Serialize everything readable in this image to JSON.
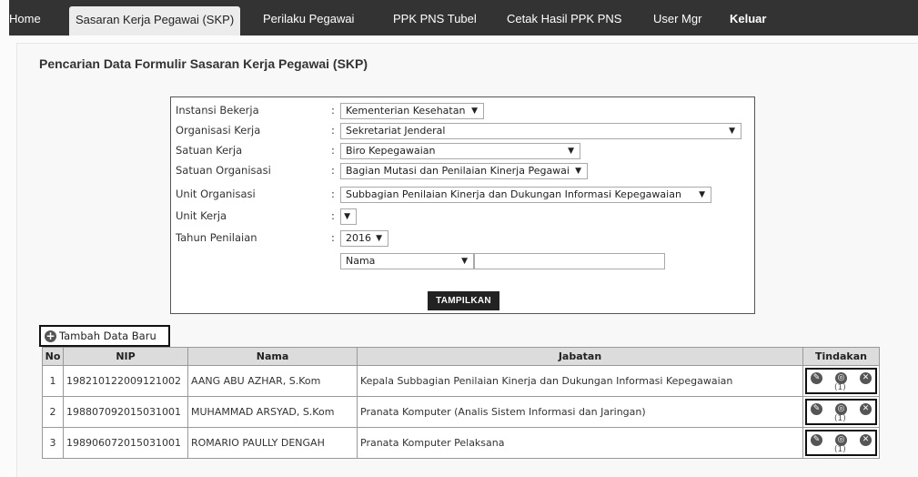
{
  "nav": {
    "items": [
      {
        "label": "Home"
      },
      {
        "label": "Sasaran Kerja Pegawai (SKP)"
      },
      {
        "label": "Perilaku Pegawai"
      },
      {
        "label": "PPK PNS Tubel"
      },
      {
        "label": "Cetak Hasil PPK PNS"
      },
      {
        "label": "User Mgr"
      },
      {
        "label": "Keluar"
      }
    ],
    "active": "Sasaran Kerja Pegawai (SKP)"
  },
  "page_title": "Pencarian Data Formulir Sasaran Kerja Pegawai (SKP)",
  "form": {
    "colon": ":",
    "rows": [
      {
        "label": "Instansi Bekerja",
        "value": "Kementerian Kesehatan"
      },
      {
        "label": "Organisasi Kerja",
        "value": "Sekretariat Jenderal"
      },
      {
        "label": "Satuan Kerja",
        "value": "Biro Kepegawaian"
      },
      {
        "label": "Satuan Organisasi",
        "value": "Bagian Mutasi dan Penilaian Kinerja Pegawai"
      },
      {
        "label": "Unit Organisasi",
        "value": "Subbagian Penilaian Kinerja dan Dukungan Informasi Kepegawaian"
      },
      {
        "label": "Unit Kerja",
        "value": ""
      },
      {
        "label": "Tahun Penilaian",
        "value": "2016"
      }
    ],
    "search_field": "Nama",
    "search_value": "",
    "submit_label": "TAMPILKAN",
    "arrow": "▼"
  },
  "add_button": {
    "icon": "plus-circle-icon",
    "label": "Tambah Data Baru"
  },
  "table": {
    "headers": [
      "No",
      "NIP",
      "Nama",
      "Jabatan",
      "Tindakan"
    ],
    "rows": [
      {
        "no": "1",
        "nip": "198210122009121002",
        "nama": "AANG ABU AZHAR, S.Kom",
        "jabatan": "Kepala Subbagian Penilaian Kinerja dan Dukungan Informasi Kepegawaian",
        "count": "(1)"
      },
      {
        "no": "2",
        "nip": "198807092015031001",
        "nama": "MUHAMMAD ARSYAD, S.Kom",
        "jabatan": "Pranata Komputer (Analis Sistem Informasi dan Jaringan)",
        "count": "(1)"
      },
      {
        "no": "3",
        "nip": "198906072015031001",
        "nama": "ROMARIO PAULLY DENGAH",
        "jabatan": "Pranata Komputer Pelaksana",
        "count": "(1)"
      }
    ],
    "action_icons": [
      "edit-icon",
      "view-icon",
      "delete-icon"
    ]
  },
  "colors": {
    "navbar": "#333333",
    "header_bg": "#dcdcdc",
    "button": "#222222"
  }
}
